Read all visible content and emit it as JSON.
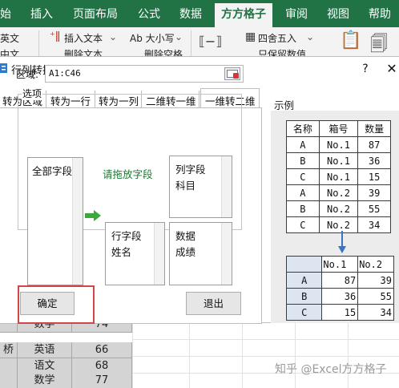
{
  "ribbon": {
    "tabs": [
      {
        "label": "始"
      },
      {
        "label": "插入"
      },
      {
        "label": "页面布局"
      },
      {
        "label": "公式"
      },
      {
        "label": "数据"
      },
      {
        "label": "方方格子"
      },
      {
        "label": "审阅"
      },
      {
        "label": "视图"
      },
      {
        "label": "帮助"
      }
    ],
    "row1": {
      "english_label": "英文",
      "insert_text": "插入文本",
      "case": "Ab 大小写",
      "round": "四舍五入"
    },
    "row2": {
      "chinese_label": "中文",
      "delete_text": "删除文本",
      "delete_space": "删除空格",
      "keep_value": "只保留数值"
    }
  },
  "dialog": {
    "title": "行列转换",
    "help": "?",
    "close": "✕",
    "tabs": [
      {
        "label": "转为区域",
        "active": false
      },
      {
        "label": "转为一行",
        "active": false
      },
      {
        "label": "转为一列",
        "active": false
      },
      {
        "label": "二维转一维",
        "active": false
      },
      {
        "label": "一维转二维",
        "active": true
      }
    ],
    "range_label": "区域:",
    "range_value": "A1:C46",
    "options_label": "选项",
    "all_fields_label": "全部字段",
    "hint": "请拖放字段",
    "col_field": {
      "title": "列字段",
      "value": "科目"
    },
    "row_field": {
      "title": "行字段",
      "value": "姓名"
    },
    "data_field": {
      "title": "数据",
      "value": "成绩"
    },
    "ok": "确定",
    "exit": "退出"
  },
  "example": {
    "label": "示例",
    "source_table": {
      "headers": [
        "名称",
        "箱号",
        "数量"
      ],
      "rows": [
        [
          "A",
          "No.1",
          "87"
        ],
        [
          "B",
          "No.1",
          "36"
        ],
        [
          "C",
          "No.1",
          "15"
        ],
        [
          "A",
          "No.2",
          "39"
        ],
        [
          "B",
          "No.2",
          "55"
        ],
        [
          "C",
          "No.2",
          "34"
        ]
      ]
    },
    "result_table": {
      "headers": [
        "No.1",
        "No.2"
      ],
      "rows": [
        {
          "name": "A",
          "v1": "87",
          "v2": "39"
        },
        {
          "name": "B",
          "v1": "36",
          "v2": "55"
        },
        {
          "name": "C",
          "v1": "15",
          "v2": "34"
        }
      ]
    }
  },
  "sheet": {
    "rows": [
      [
        "",
        "数学",
        "74"
      ],
      [
        "桥",
        "英语",
        "66"
      ],
      [
        "",
        "语文",
        "68"
      ],
      [
        "",
        "数学",
        "77"
      ]
    ]
  },
  "watermark": "知乎 @Excel方方格子",
  "colors": {
    "accent": "#217346",
    "hint_green": "#1a7a2f",
    "highlight_red": "#d64545",
    "table_header": "#dde5f0"
  }
}
